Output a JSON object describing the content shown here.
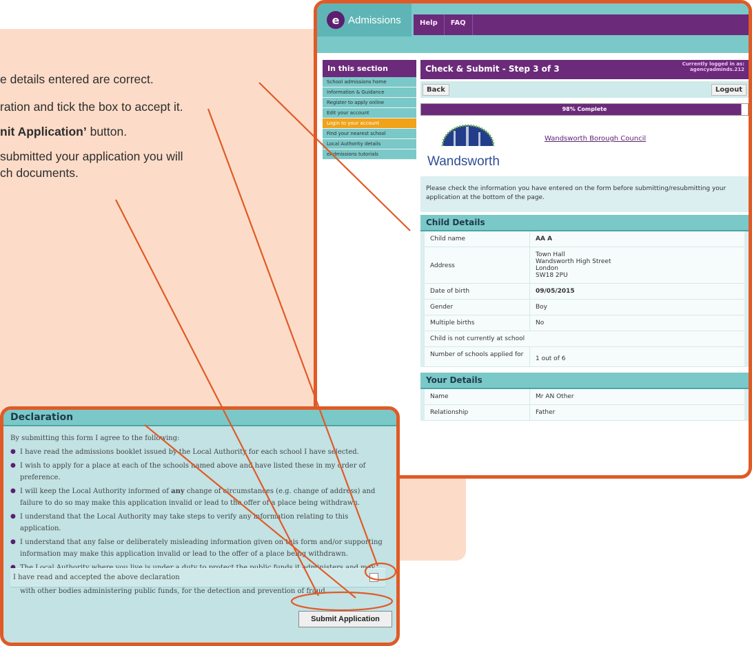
{
  "instructions": {
    "line1": "e details entered are correct.",
    "line2": "ration and tick the box to accept it.",
    "line3_bold": "nit Application’",
    "line3_rest": " button.",
    "line4": "submitted your application you will",
    "line5": "ch documents."
  },
  "app": {
    "logo_letter": "e",
    "logo_text": "Admissions",
    "top_menu": [
      "Help",
      "FAQ"
    ],
    "sidebar": {
      "header": "In this section",
      "items": [
        "School admissions home",
        "Information & Guidance",
        "Register to apply online",
        "Edit your account",
        "Login to your account",
        "Find your nearest school",
        "Local Authority details",
        "eAdmissions tutorials"
      ],
      "active_index": 4
    },
    "page_title": "Check & Submit - Step 3 of 3",
    "logged_in_line1": "Currently logged in as:",
    "logged_in_line2": "agencyadminds.212",
    "back_label": "Back",
    "logout_label": "Logout",
    "progress_text": "98% Complete",
    "progress_value": 0.98,
    "council_link": "Wandsworth Borough Council",
    "council_logo_text": "Wandsworth",
    "notice": "Please check the information you have entered on the form before submitting/resubmitting your application at the bottom of the page.",
    "child_section": "Child Details",
    "child_rows": [
      {
        "k": "Child name",
        "v": "AA A"
      },
      {
        "k": "Address",
        "v": "Town Hall\nWandsworth High Street\nLondon\nSW18 2PU"
      },
      {
        "k": "Date of birth",
        "v": "09/05/2015"
      },
      {
        "k": "Gender",
        "v": "Boy"
      },
      {
        "k": "Multiple births",
        "v": "No"
      },
      {
        "k": "Child is not currently at school",
        "v": ""
      },
      {
        "k": "Number of schools applied for",
        "v": "1 out of 6"
      }
    ],
    "your_section": "Your Details",
    "your_rows": [
      {
        "k": "Name",
        "v": "Mr AN Other"
      },
      {
        "k": "Relationship",
        "v": "Father"
      }
    ]
  },
  "declaration": {
    "title": "Declaration",
    "intro": "By submitting this form I agree to the following:",
    "items": [
      "I have read the admissions booklet issued by the Local Authority for each school I have selected.",
      "I wish to apply for a place at each of the schools named above and have listed these in my order of preference.",
      "I will keep the Local Authority informed of any change of circumstances (e.g. change of address) and failure to do so may make this application invalid or lead to the offer of a place being withdrawn.",
      "I understand that the Local Authority may take steps to verify any information relating to this application.",
      "I understand that any false or deliberately misleading information given on this form and/or supporting information may make this application invalid or lead to the offer of a place being withdrawn.",
      "The Local Authority where you live is under a duty to protect the public funds it administers and may therefore share the information you have provided in this application within the Local Authority and with other bodies administering public funds, for the detection and prevention of fraud."
    ],
    "accept_label": "I have read and accepted the above declaration",
    "accepted": false,
    "submit_label": "Submit Application"
  },
  "colors": {
    "frame": "#e05a26",
    "panel": "#fcdcc8",
    "purple": "#6b2a7a",
    "teal": "#7bc8c8",
    "nav_active": "#f0a21a"
  }
}
